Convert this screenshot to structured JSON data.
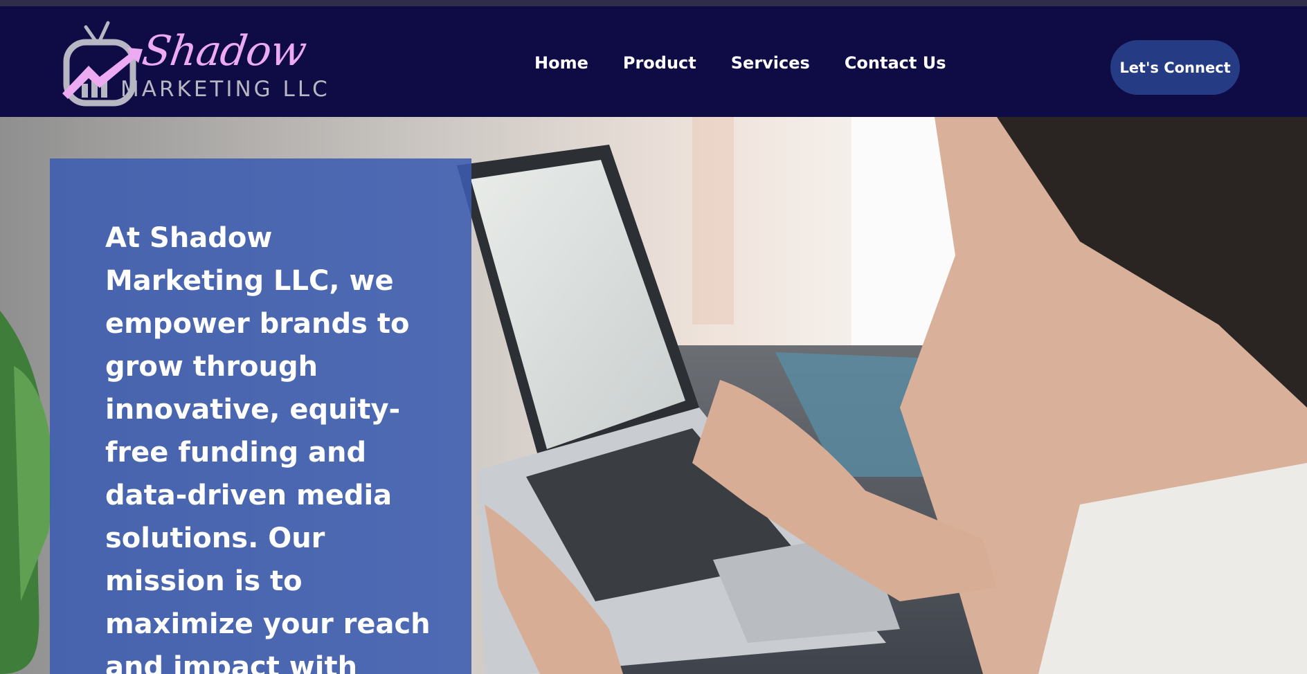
{
  "header": {
    "logo": {
      "script_text": "Shadow",
      "sub_text": "MARKETING LLC",
      "icon": "tv-growth-arrow-icon"
    },
    "nav": [
      {
        "label": "Home"
      },
      {
        "label": "Product"
      },
      {
        "label": "Services"
      },
      {
        "label": "Contact Us"
      }
    ],
    "cta_label": "Let's Connect"
  },
  "hero": {
    "image": "photo-woman-typing-on-laptop",
    "text": "At Shadow Marketing LLC, we empower brands to grow through innovative, equity-free funding and data-driven media solutions. Our mission is to maximize your reach and impact with"
  },
  "colors": {
    "header_bg": "#0e0b45",
    "cta_bg": "#253c85",
    "overlay_bg": "#3c5cb0",
    "logo_accent": "#ecaaf2"
  }
}
